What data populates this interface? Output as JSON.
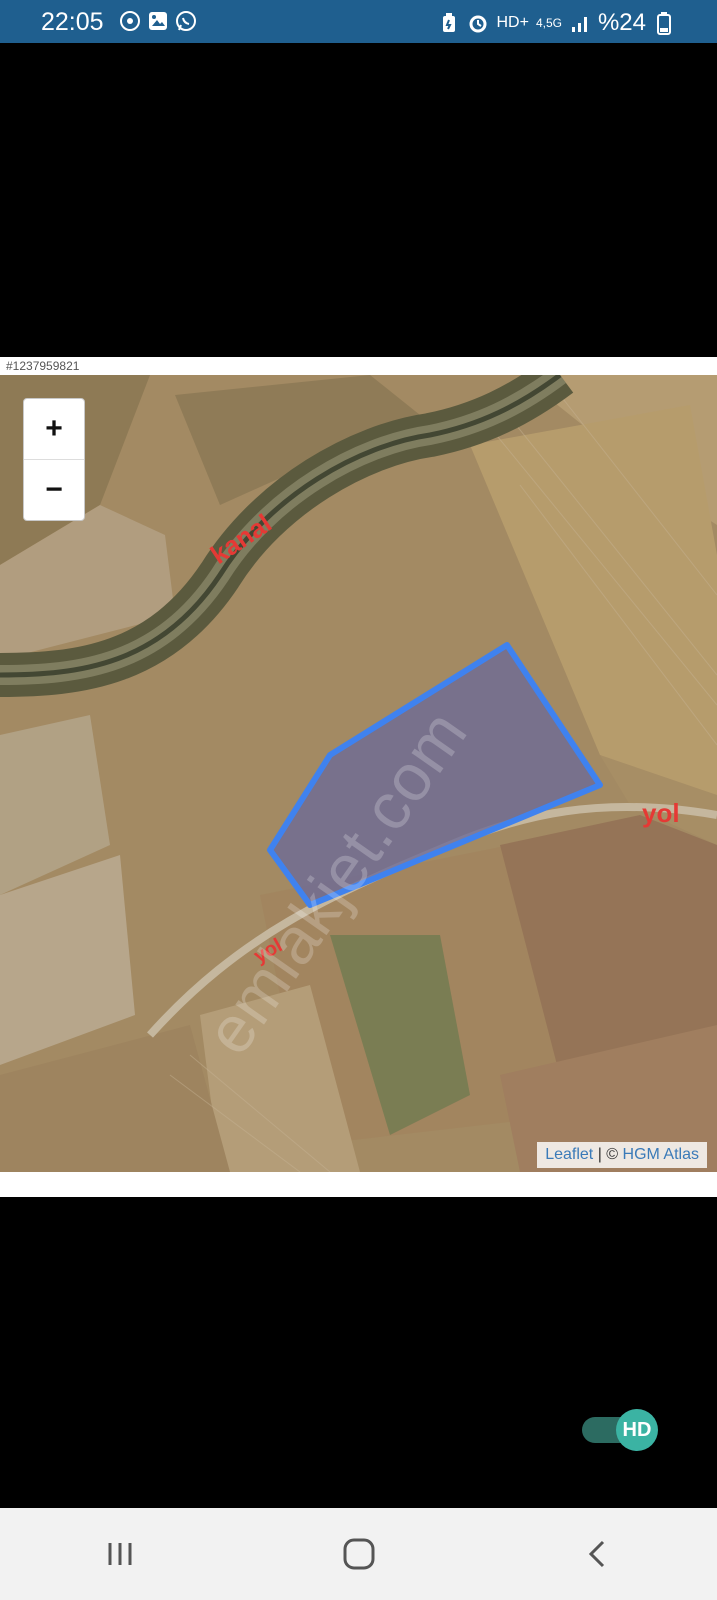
{
  "status_bar": {
    "time": "22:05",
    "network_hd": "HD+",
    "network_type": "4,5G",
    "battery": "%24",
    "left_icons": [
      "whatsapp-icon",
      "gallery-icon",
      "notification-icon"
    ],
    "right_icons": [
      "battery-saver-icon",
      "alarm-icon",
      "signal-icon",
      "battery-icon"
    ]
  },
  "listing": {
    "id": "#1237959821"
  },
  "map": {
    "zoom_in": "+",
    "zoom_out": "−",
    "labels": {
      "canal": "kanal",
      "road_right": "yol",
      "road_left": "yol"
    },
    "watermark": "emlakjet.com",
    "attribution": {
      "leaflet": "Leaflet",
      "separator": " | © ",
      "provider": "HGM Atlas"
    },
    "parcel_stroke_color": "#3f82ef",
    "parcel_fill_color": "#6c6a97"
  },
  "hd_toggle": {
    "label": "HD",
    "on": true
  },
  "nav": {
    "recent": "recent-apps-icon",
    "home": "home-icon",
    "back": "back-icon"
  }
}
